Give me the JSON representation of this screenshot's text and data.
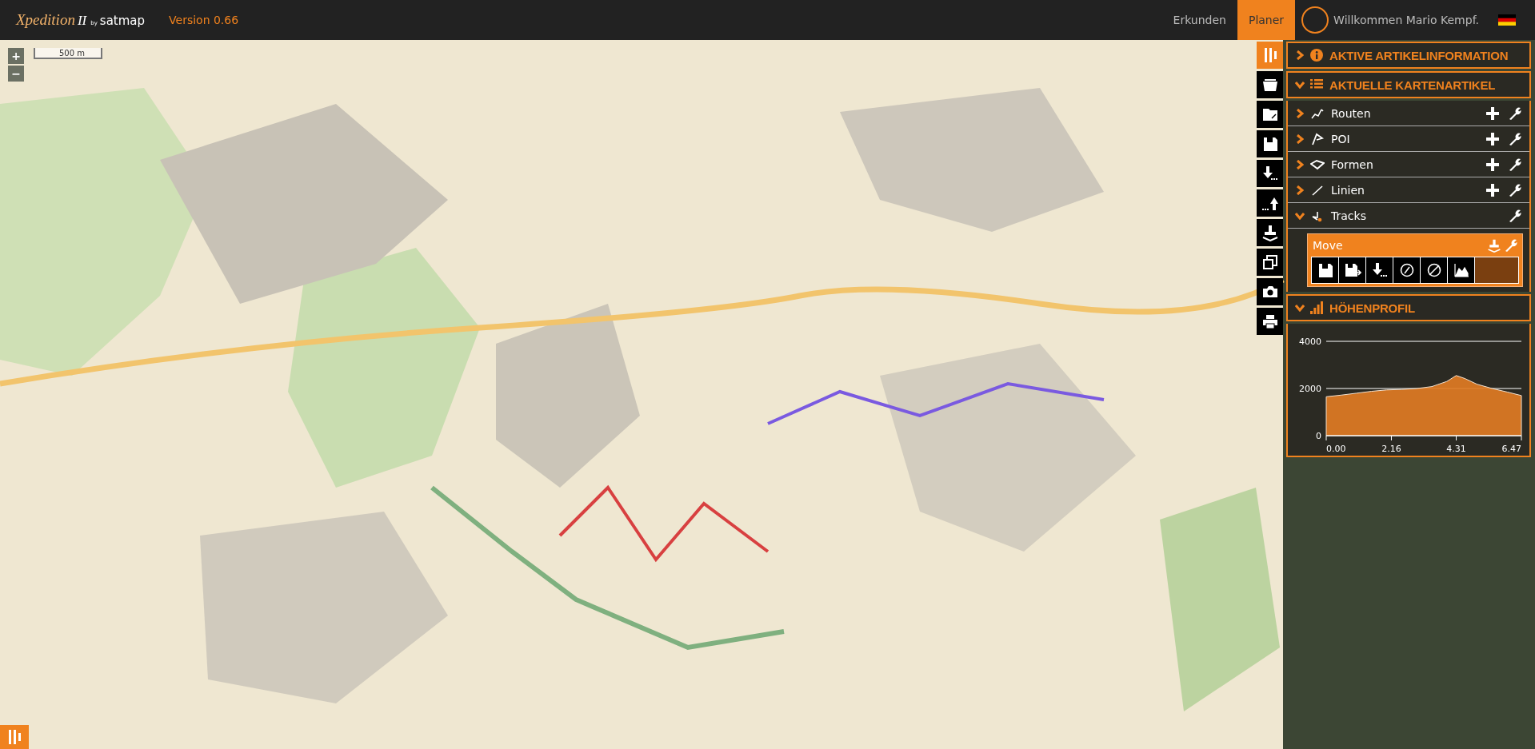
{
  "header": {
    "logo": {
      "brand": "Xpedition",
      "numeral": "II",
      "by": "by",
      "maker": "satmap"
    },
    "version": "Version 0.66",
    "nav": [
      {
        "label": "Erkunden",
        "selected": false
      },
      {
        "label": "Planer",
        "selected": true
      }
    ],
    "welcome": "Willkommen Mario Kempf."
  },
  "map": {
    "scale": "500 m",
    "zoom_in": "+",
    "zoom_out": "−"
  },
  "toolbar": [
    {
      "kind": "panel",
      "selected": true
    },
    {
      "kind": "open",
      "selected": false
    },
    {
      "kind": "folder-edit",
      "selected": false
    },
    {
      "kind": "save",
      "selected": false
    },
    {
      "kind": "import",
      "selected": false
    },
    {
      "kind": "export",
      "selected": false
    },
    {
      "kind": "stamp",
      "selected": false
    },
    {
      "kind": "copy",
      "selected": false
    },
    {
      "kind": "camera",
      "selected": false
    },
    {
      "kind": "print",
      "selected": false
    }
  ],
  "panel": {
    "sections": [
      {
        "kind": "info",
        "title": "AKTIVE ARTIKELINFORMATION",
        "expanded": false
      },
      {
        "kind": "list",
        "title": "AKTUELLE KARTENARTIKEL",
        "expanded": true
      }
    ],
    "categories": [
      {
        "kind": "route",
        "label": "Routen",
        "expanded": false,
        "addable": true
      },
      {
        "kind": "poi",
        "label": "POI",
        "expanded": false,
        "addable": true
      },
      {
        "kind": "shape",
        "label": "Formen",
        "expanded": false,
        "addable": true
      },
      {
        "kind": "line",
        "label": "Linien",
        "expanded": false,
        "addable": true
      },
      {
        "kind": "track",
        "label": "Tracks",
        "expanded": true,
        "addable": false,
        "children": [
          {
            "label": "Move",
            "actions": [
              {
                "kind": "save"
              },
              {
                "kind": "save-as"
              },
              {
                "kind": "import"
              },
              {
                "kind": "sync"
              },
              {
                "kind": "reverse"
              },
              {
                "kind": "profile"
              }
            ]
          }
        ]
      }
    ],
    "profile": {
      "title": "HÖHENPROFIL",
      "expanded": true,
      "chart_data": {
        "type": "area",
        "x": [
          0,
          0.5,
          1,
          1.5,
          2,
          2.5,
          3,
          3.5,
          4,
          4.31,
          4.6,
          5,
          5.5,
          6,
          6.47
        ],
        "series": [
          {
            "color": "#e07b24",
            "values": [
              1650,
              1720,
              1800,
              1880,
              1940,
              1960,
              2000,
              2080,
              2300,
              2550,
              2420,
              2180,
              2000,
              1850,
              1700
            ]
          }
        ],
        "xlim": [
          0,
          6.47
        ],
        "ylim": [
          0,
          4000
        ],
        "xticks": [
          {
            "value": 0,
            "label": "0.00"
          },
          {
            "value": 2.16,
            "label": "2.16"
          },
          {
            "value": 4.31,
            "label": "4.31"
          },
          {
            "value": 6.47,
            "label": "6.47"
          }
        ],
        "yticks": [
          0,
          2000,
          4000
        ]
      }
    }
  }
}
